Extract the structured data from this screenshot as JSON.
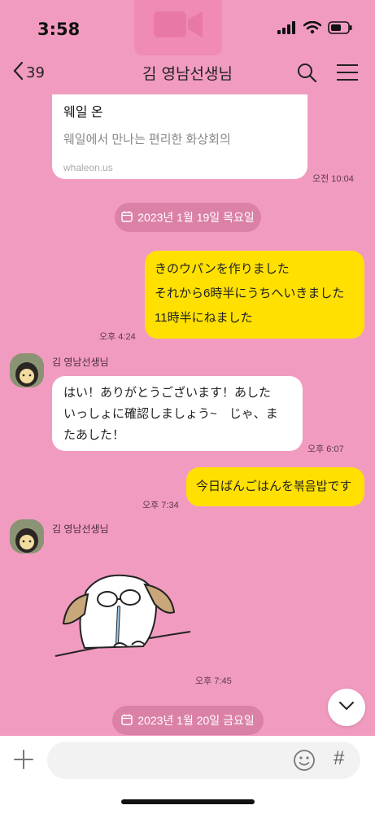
{
  "status": {
    "time": "3:58"
  },
  "header": {
    "back_count": "39",
    "title": "김 영남선생님"
  },
  "link_preview": {
    "title": "웨일 온",
    "description": "웨일에서 만나는 편리한 화상회의",
    "domain": "whaleon.us",
    "time": "오전 10:04"
  },
  "dates": [
    "2023년 1월 19일 목요일",
    "2023년 1월 20일 금요일"
  ],
  "messages": {
    "me1": {
      "lines": [
        "きのウパンを作りました",
        "それから6時半にうちへいきました",
        "11時半にねました"
      ],
      "time": "오후 4:24"
    },
    "them1": {
      "sender": "김 영남선생님",
      "lines": [
        "はい！ありがとうございます！あした",
        "いっしょに確認しましょう~　じゃ、ま",
        "たあした！"
      ],
      "time": "오후 6:07"
    },
    "me2": {
      "text": "今日ばんごはんを볶음밥です",
      "time": "오후 7:34"
    },
    "them2": {
      "sender": "김 영남선생님",
      "time": "오후 7:45"
    }
  },
  "icons": {
    "back": "chevron-left-icon",
    "search": "search-icon",
    "menu": "menu-icon",
    "calendar": "calendar-icon",
    "scroll": "chevron-down-icon",
    "plus": "plus-icon",
    "emoji": "emoji-icon",
    "hash": "hash-icon"
  },
  "input": {
    "placeholder": "",
    "hash_label": "#"
  },
  "colors": {
    "background": "#f29bc1",
    "my_bubble": "#ffe000",
    "their_bubble": "#ffffff"
  }
}
